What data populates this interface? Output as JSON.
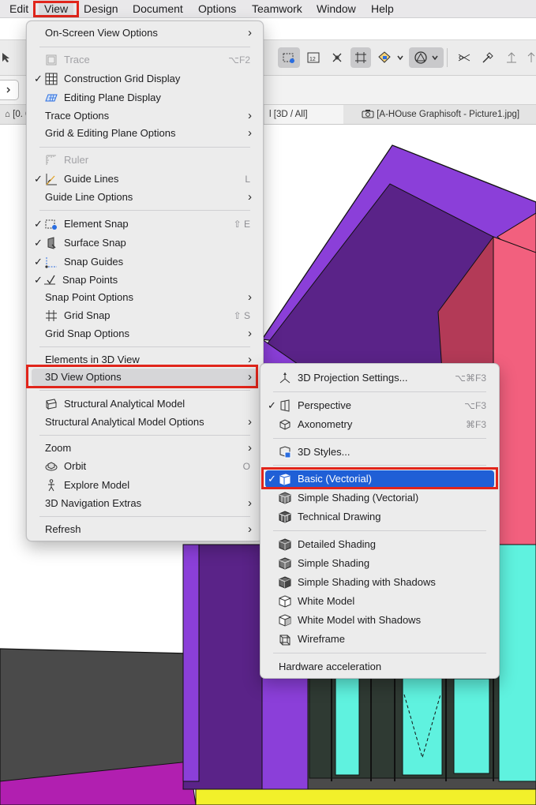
{
  "menubar": {
    "items": [
      "Edit",
      "View",
      "Design",
      "Document",
      "Options",
      "Teamwork",
      "Window",
      "Help"
    ],
    "active": "View"
  },
  "tabs": [
    "[0. 0",
    "l [3D / All]",
    "[A-HOuse Graphisoft  - Picture1.jpg]"
  ],
  "view_menu": [
    {
      "label": "On-Screen View Options",
      "submenu": true
    },
    {
      "label": "Trace",
      "icon": "trace-icon",
      "shortcut": "⌥F2",
      "disabled": true
    },
    {
      "label": "Construction Grid Display",
      "icon": "construction-grid-icon",
      "checked": true
    },
    {
      "label": "Editing Plane Display",
      "icon": "editing-plane-icon"
    },
    {
      "label": "Trace Options",
      "submenu": true
    },
    {
      "label": "Grid & Editing Plane Options",
      "submenu": true
    },
    {
      "label": "Ruler",
      "icon": "ruler-icon",
      "disabled": true
    },
    {
      "label": "Guide Lines",
      "icon": "guide-lines-icon",
      "checked": true,
      "shortcut": "L"
    },
    {
      "label": "Guide Line Options",
      "submenu": true
    },
    {
      "label": "Element Snap",
      "icon": "element-snap-icon",
      "checked": true,
      "shortcut": "⇧ E"
    },
    {
      "label": "Surface Snap",
      "icon": "surface-snap-icon",
      "checked": true
    },
    {
      "label": "Snap Guides",
      "icon": "snap-guides-icon",
      "checked": true
    },
    {
      "label": "Snap Points",
      "icon": "snap-points-icon",
      "checked": true
    },
    {
      "label": "Snap Point Options",
      "submenu": true
    },
    {
      "label": "Grid Snap",
      "icon": "grid-snap-icon",
      "shortcut": "⇧ S"
    },
    {
      "label": "Grid Snap Options",
      "submenu": true
    },
    {
      "label": "Elements in 3D View",
      "submenu": true
    },
    {
      "label": "3D View Options",
      "submenu": true,
      "highlighted": true
    },
    {
      "label": "Structural Analytical Model",
      "icon": "structural-model-icon"
    },
    {
      "label": "Structural Analytical Model Options",
      "submenu": true
    },
    {
      "label": "Zoom",
      "submenu": true
    },
    {
      "label": "Orbit",
      "icon": "orbit-icon",
      "shortcut": "O"
    },
    {
      "label": "Explore Model",
      "icon": "explore-model-icon"
    },
    {
      "label": "3D Navigation Extras",
      "submenu": true
    },
    {
      "label": "Refresh",
      "submenu": true
    }
  ],
  "submenu_3d": [
    {
      "label": "3D Projection Settings...",
      "icon": "projection-settings-icon",
      "shortcut": "⌥⌘F3"
    },
    {
      "label": "Perspective",
      "icon": "perspective-icon",
      "checked": true,
      "shortcut": "⌥F3"
    },
    {
      "label": "Axonometry",
      "icon": "axonometry-icon",
      "shortcut": "⌘F3"
    },
    {
      "label": "3D Styles...",
      "icon": "3d-styles-icon"
    },
    {
      "label": "Basic (Vectorial)",
      "icon": "basic-vectorial-icon",
      "checked": true,
      "selected": true
    },
    {
      "label": "Simple Shading (Vectorial)",
      "icon": "simple-shading-vectorial-icon"
    },
    {
      "label": "Technical Drawing",
      "icon": "technical-drawing-icon"
    },
    {
      "label": "Detailed Shading",
      "icon": "detailed-shading-icon"
    },
    {
      "label": "Simple Shading",
      "icon": "simple-shading-icon"
    },
    {
      "label": "Simple Shading with Shadows",
      "icon": "simple-shading-shadows-icon"
    },
    {
      "label": "White Model",
      "icon": "white-model-icon"
    },
    {
      "label": "White Model with Shadows",
      "icon": "white-model-shadows-icon"
    },
    {
      "label": "Wireframe",
      "icon": "wireframe-icon"
    },
    {
      "label": "Hardware acceleration"
    }
  ],
  "colors": {
    "highlight_blue": "#1f5fd6",
    "annotation_red": "#e1251b",
    "model_purple": "#8b3fd9",
    "model_dark_purple": "#5a2388",
    "model_red": "#b33a57",
    "model_pink": "#f2607e",
    "model_cyan": "#5ff2df",
    "model_gray": "#4a4a4a",
    "model_magenta": "#b11fb0",
    "model_yellow": "#f2f02a"
  }
}
